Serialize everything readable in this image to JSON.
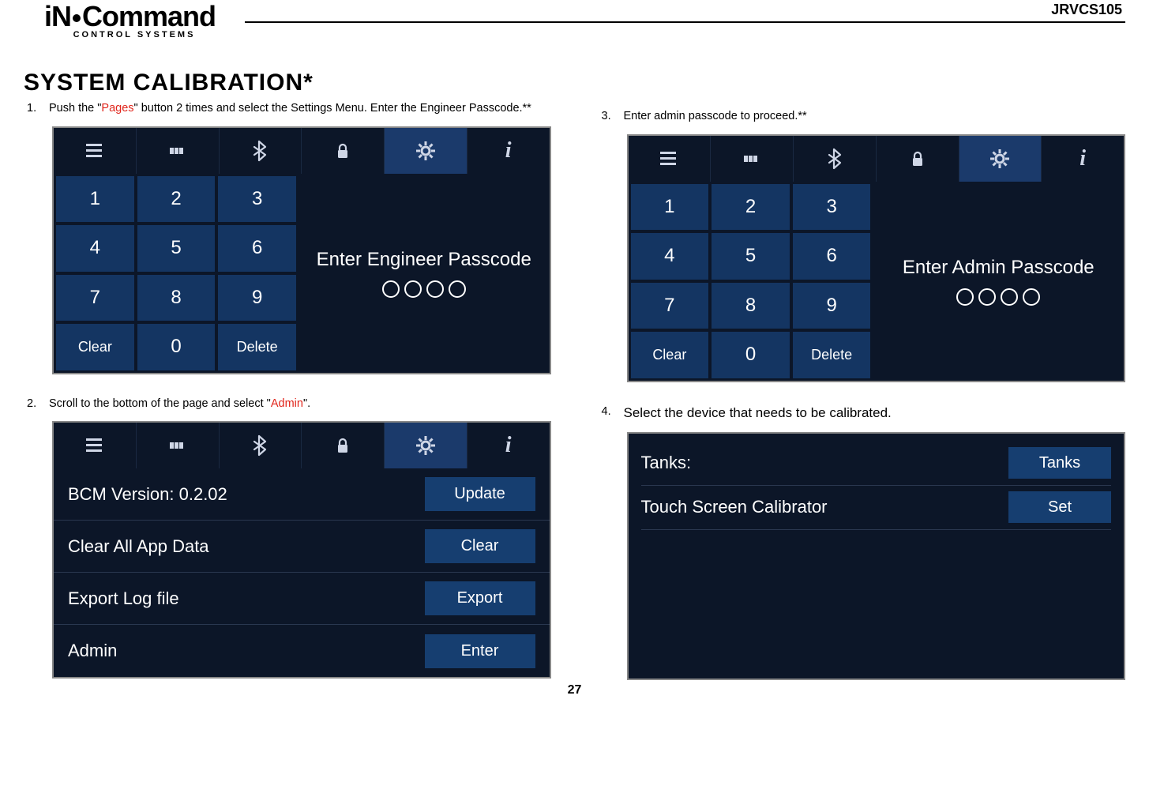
{
  "header": {
    "logo_main_left": "iN",
    "logo_main_right": "Command",
    "logo_tm": "™",
    "logo_sub": "CONTROL SYSTEMS",
    "model": "JRVCS105"
  },
  "page_title": "SYSTEM CALIBRATION*",
  "page_number": "27",
  "steps": {
    "s1_num": "1.",
    "s1_a": "Push the \"",
    "s1_pages": "Pages",
    "s1_b": "\" button 2 times and select the Settings Menu. Enter the Engineer Passcode.**",
    "s2_num": "2.",
    "s2_a": "Scroll to the bottom of the page and select \"",
    "s2_admin": "Admin",
    "s2_b": "\".",
    "s3_num": "3.",
    "s3_text": "Enter admin passcode to proceed.**",
    "s4_num": "4.",
    "s4_text": "Select the device that needs to be calibrated."
  },
  "keypad": {
    "k1": "1",
    "k2": "2",
    "k3": "3",
    "k4": "4",
    "k5": "5",
    "k6": "6",
    "k7": "7",
    "k8": "8",
    "k9": "9",
    "clear": "Clear",
    "k0": "0",
    "delete": "Delete"
  },
  "prompts": {
    "engineer": "Enter Engineer Passcode",
    "admin": "Enter Admin Passcode"
  },
  "settings_list": [
    {
      "label": "BCM Version:  0.2.02",
      "button": "Update"
    },
    {
      "label": "Clear All App Data",
      "button": "Clear"
    },
    {
      "label": "Export Log file",
      "button": "Export"
    },
    {
      "label": "Admin",
      "button": "Enter"
    }
  ],
  "calibrate_list": [
    {
      "label": "Tanks:",
      "button": "Tanks"
    },
    {
      "label": "Touch Screen Calibrator",
      "button": "Set"
    }
  ],
  "icons": {
    "info": "i"
  }
}
